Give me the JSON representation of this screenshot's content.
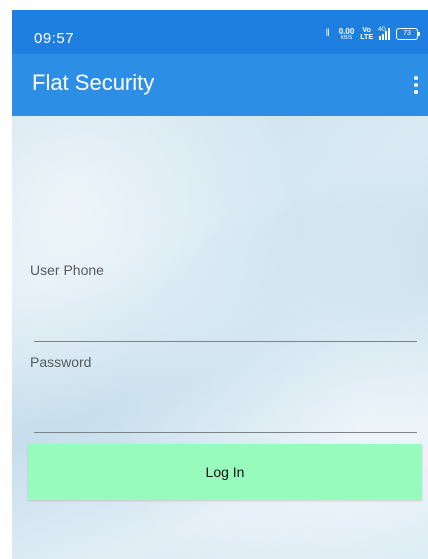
{
  "status_bar": {
    "time": "09:57",
    "network_speed": "0.00",
    "network_speed_unit": "KB/S",
    "volte_top": "Vo",
    "volte_bottom": "LTE",
    "network_type": "4G",
    "battery_level": "73",
    "icons": [
      "vibrate-icon",
      "signal-icon",
      "battery-icon"
    ]
  },
  "app_bar": {
    "title": "Flat Security",
    "menu_icon": "overflow-menu-icon"
  },
  "form": {
    "phone_label": "User Phone",
    "phone_value": "",
    "password_label": "Password",
    "password_value": "",
    "login_label": "Log In"
  },
  "colors": {
    "status_bar": "#1f7fe0",
    "app_bar": "#2d8ee6",
    "login_button": "#98fbbe"
  }
}
